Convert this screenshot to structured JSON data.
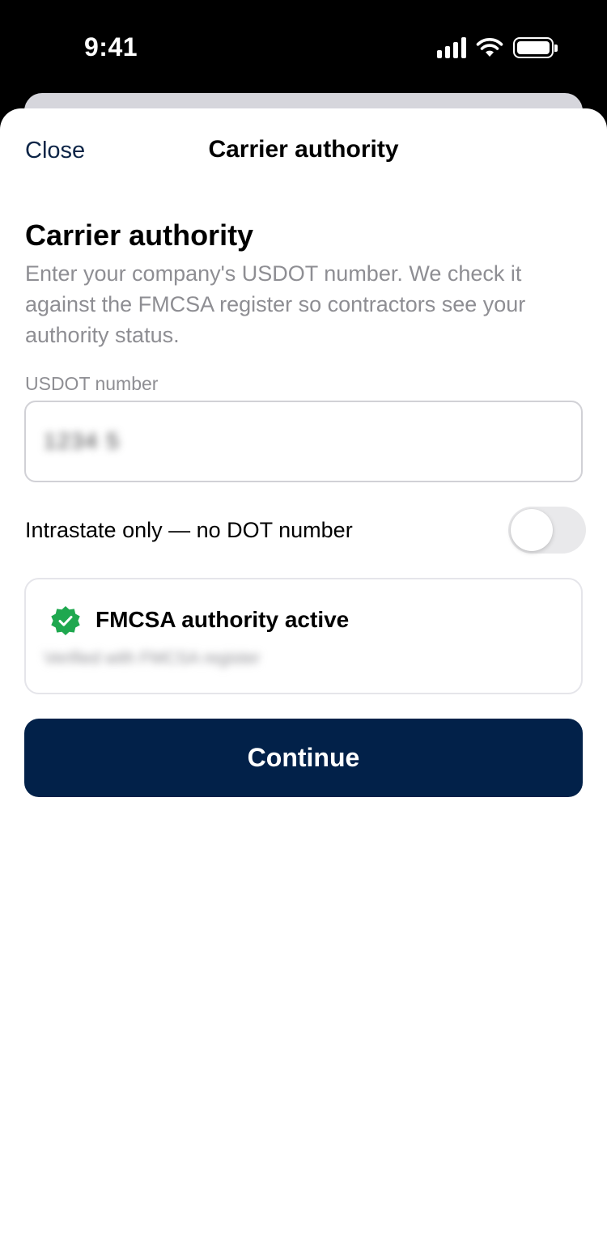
{
  "status_bar": {
    "time": "9:41",
    "icons": [
      "signal-icon",
      "wifi-icon",
      "battery-icon"
    ]
  },
  "nav": {
    "close_label": "Close",
    "title": "Carrier authority"
  },
  "form": {
    "heading": "Carrier authority",
    "description": "Enter your company's USDOT number. We check it against the FMCSA register so contractors see your authority status.",
    "usdot_label": "USDOT number",
    "usdot_value": "1234 5",
    "intrastate_label": "Intrastate only — no DOT number",
    "intrastate_enabled": false
  },
  "authority_card": {
    "title": "FMCSA authority active",
    "subtitle": "Verified with FMCSA register",
    "icon": "verified-badge-icon",
    "icon_color": "#1fa84f"
  },
  "actions": {
    "continue_label": "Continue",
    "continue_color": "#022149"
  }
}
